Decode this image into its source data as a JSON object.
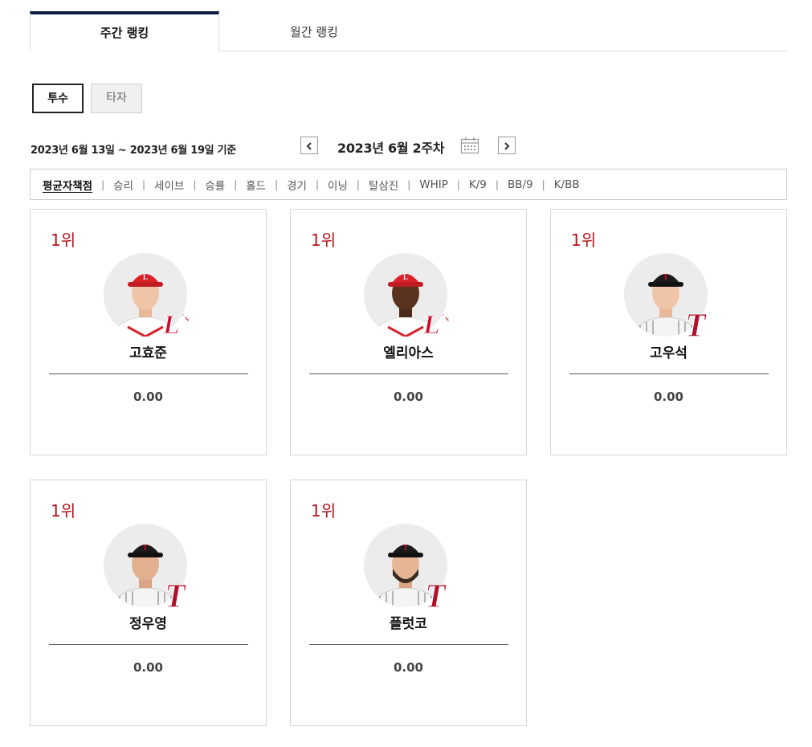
{
  "tabs": [
    {
      "label": "주간 랭킹",
      "active": true
    },
    {
      "label": "월간 랭킹",
      "active": false
    }
  ],
  "type_buttons": [
    {
      "label": "투수",
      "active": true
    },
    {
      "label": "타자",
      "active": false
    }
  ],
  "date": {
    "range": "2023년 6월 13일 ~ 2023년 6월 19일 기준",
    "week_label": "2023년 6월 2주차",
    "prev_icon": "chevron-left-icon",
    "next_icon": "chevron-right-icon",
    "calendar_icon": "calendar-icon"
  },
  "categories": [
    {
      "label": "평균자책점",
      "active": true
    },
    {
      "label": "승리",
      "active": false
    },
    {
      "label": "세이브",
      "active": false
    },
    {
      "label": "승률",
      "active": false
    },
    {
      "label": "홀드",
      "active": false
    },
    {
      "label": "경기",
      "active": false
    },
    {
      "label": "이닝",
      "active": false
    },
    {
      "label": "탈삼진",
      "active": false
    },
    {
      "label": "WHIP",
      "active": false
    },
    {
      "label": "K/9",
      "active": false
    },
    {
      "label": "BB/9",
      "active": false
    },
    {
      "label": "K/BB",
      "active": false
    }
  ],
  "players": [
    {
      "rank": "1위",
      "name": "고효준",
      "value": "0.00",
      "team_logo": "L's",
      "cap_color": "#d8232a",
      "logo_color": "#c8102e"
    },
    {
      "rank": "1위",
      "name": "엘리아스",
      "value": "0.00",
      "team_logo": "L's",
      "cap_color": "#d8232a",
      "logo_color": "#c8102e"
    },
    {
      "rank": "1위",
      "name": "고우석",
      "value": "0.00",
      "team_logo": "T",
      "cap_color": "#1a1a1a",
      "logo_color": "#b0102a"
    },
    {
      "rank": "1위",
      "name": "정우영",
      "value": "0.00",
      "team_logo": "T",
      "cap_color": "#1a1a1a",
      "logo_color": "#b0102a"
    },
    {
      "rank": "1위",
      "name": "플럿코",
      "value": "0.00",
      "team_logo": "T",
      "cap_color": "#1a1a1a",
      "logo_color": "#b0102a"
    }
  ],
  "colors": {
    "accent_navy": "#0e1e42",
    "rank_red": "#b3121b"
  }
}
